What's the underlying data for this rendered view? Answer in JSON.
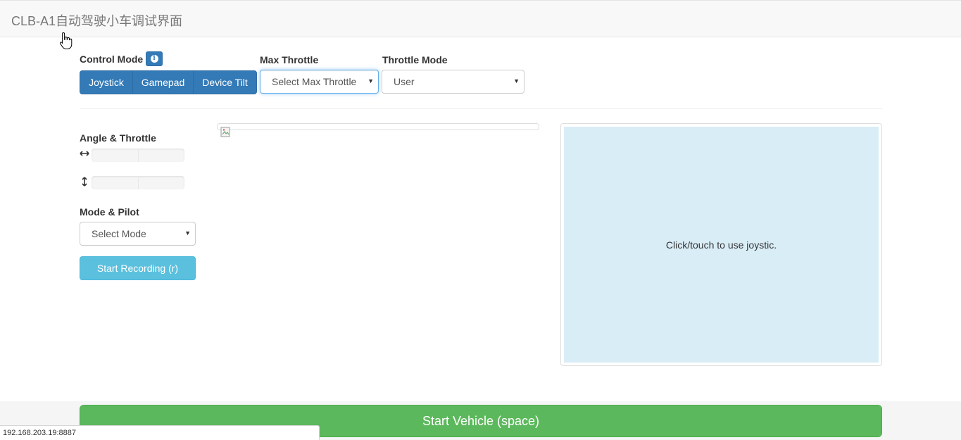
{
  "navbar": {
    "brand": "CLB-A1自动驾驶小车调试界面"
  },
  "control_mode": {
    "label": "Control Mode",
    "info_icon": "info-circle-icon",
    "buttons": [
      {
        "label": "Joystick"
      },
      {
        "label": "Gamepad"
      },
      {
        "label": "Device Tilt"
      }
    ]
  },
  "max_throttle": {
    "label": "Max Throttle",
    "selected": "Select Max Throttle"
  },
  "throttle_mode": {
    "label": "Throttle Mode",
    "selected": "User"
  },
  "angle_throttle": {
    "label": "Angle & Throttle",
    "angle_icon": "horizontal-arrows-icon",
    "throttle_icon": "vertical-arrows-icon"
  },
  "mode_pilot": {
    "label": "Mode & Pilot",
    "selected": "Select Mode"
  },
  "record_button": {
    "label": "Start Recording (r)"
  },
  "joystick": {
    "hint": "Click/touch to use joystic."
  },
  "start_button": {
    "label": "Start Vehicle (space)"
  },
  "status_bar": {
    "url": "192.168.203.19:8887"
  },
  "colors": {
    "primary": "#337ab7",
    "info": "#5bc0de",
    "success": "#5cb85c",
    "joystick_bg": "#d9edf7"
  }
}
